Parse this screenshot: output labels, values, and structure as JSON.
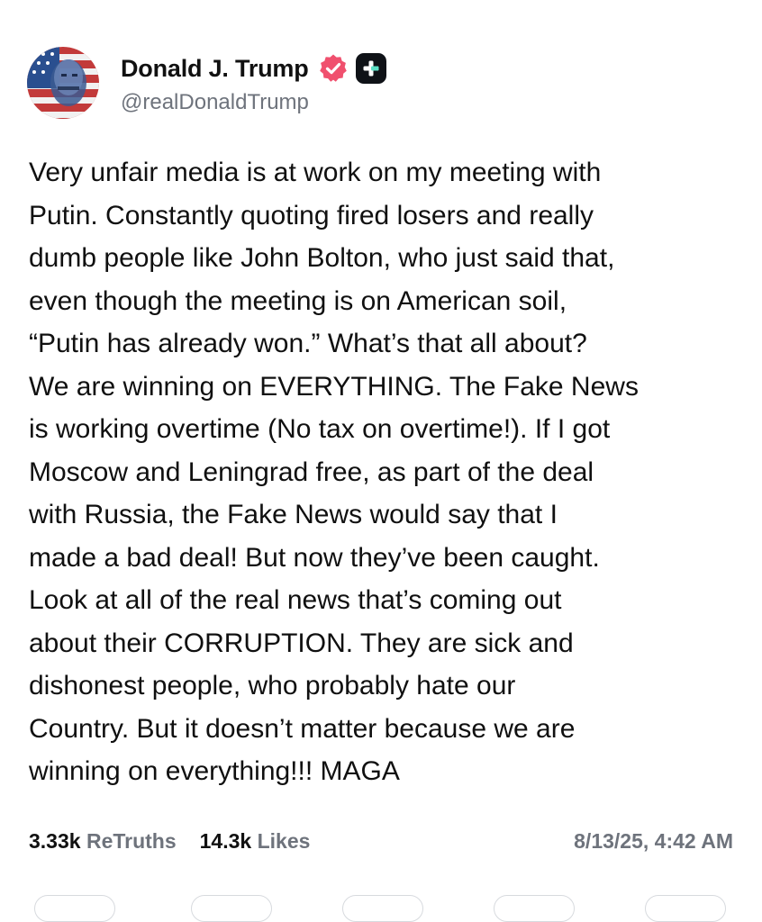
{
  "author": {
    "display_name": "Donald J. Trump",
    "handle": "@realDonaldTrump",
    "verified_color": "#f0506e",
    "avatar_icon": "profile-avatar"
  },
  "post": {
    "text": "Very unfair media is at work on my meeting with\nPutin. Constantly quoting fired losers and really\ndumb people like John Bolton, who just said that,\neven though the meeting is on American soil,\n“Putin has already won.” What’s that all about?\nWe are winning on EVERYTHING. The Fake News\nis working overtime (No tax on overtime!). If I got\nMoscow and Leningrad free, as part of the deal\nwith Russia, the Fake News would say that I\nmade a bad deal! But now they’ve been caught.\nLook at all of the real news that’s coming out\nabout their CORRUPTION. They are sick and\ndishonest people, who probably hate our\nCountry. But it doesn’t matter because we are\nwinning on everything!!! MAGA"
  },
  "stats": {
    "retruths_count": "3.33k",
    "retruths_label": "ReTruths",
    "likes_count": "14.3k",
    "likes_label": "Likes",
    "timestamp": "8/13/25, 4:42 AM"
  }
}
